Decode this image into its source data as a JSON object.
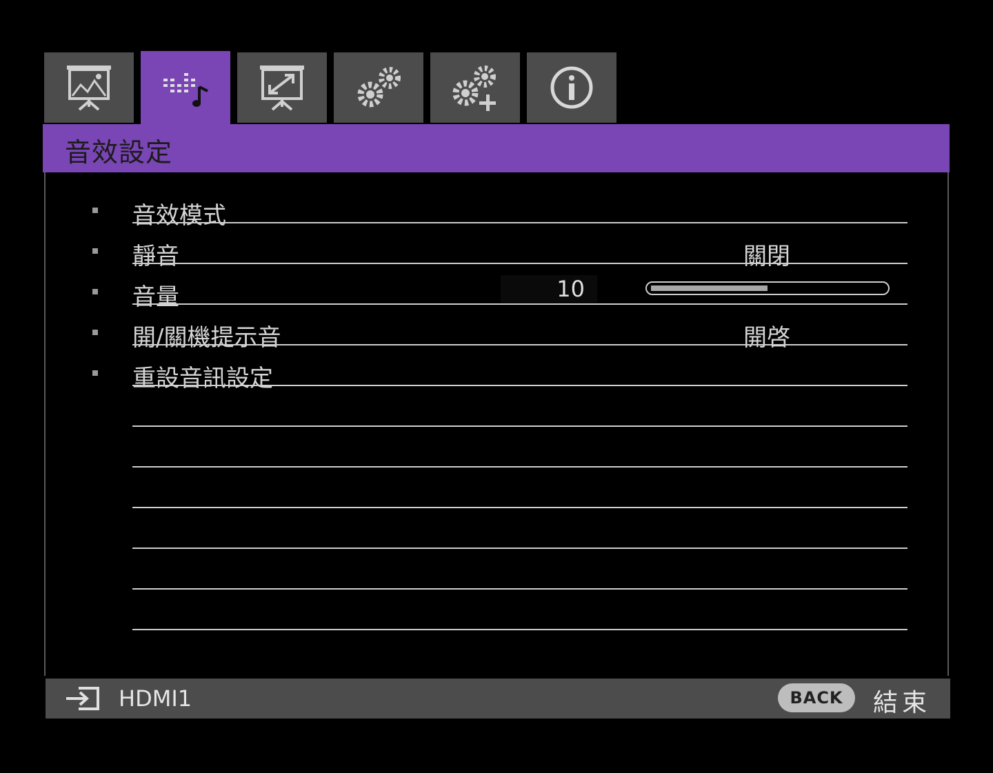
{
  "tabs": [
    {
      "icon": "picture-icon",
      "active": false
    },
    {
      "icon": "audio-icon",
      "active": true
    },
    {
      "icon": "display-icon",
      "active": false
    },
    {
      "icon": "settings-icon",
      "active": false
    },
    {
      "icon": "advanced-settings-icon",
      "active": false
    },
    {
      "icon": "info-icon",
      "active": false
    }
  ],
  "header": {
    "title": "音效設定"
  },
  "rows": [
    {
      "label": "音效模式",
      "value": ""
    },
    {
      "label": "靜音",
      "value": "關閉"
    },
    {
      "label": "音量",
      "number": "10",
      "level": 0.5
    },
    {
      "label": "開/關機提示音",
      "value": "開啓"
    },
    {
      "label": "重設音訊設定",
      "value": ""
    }
  ],
  "footer": {
    "source": "HDMI1",
    "back_label": "BACK",
    "exit_label": "結束"
  },
  "colors": {
    "accent": "#7a45b4",
    "tab_bg": "#4c4c4c",
    "background": "#000000"
  }
}
